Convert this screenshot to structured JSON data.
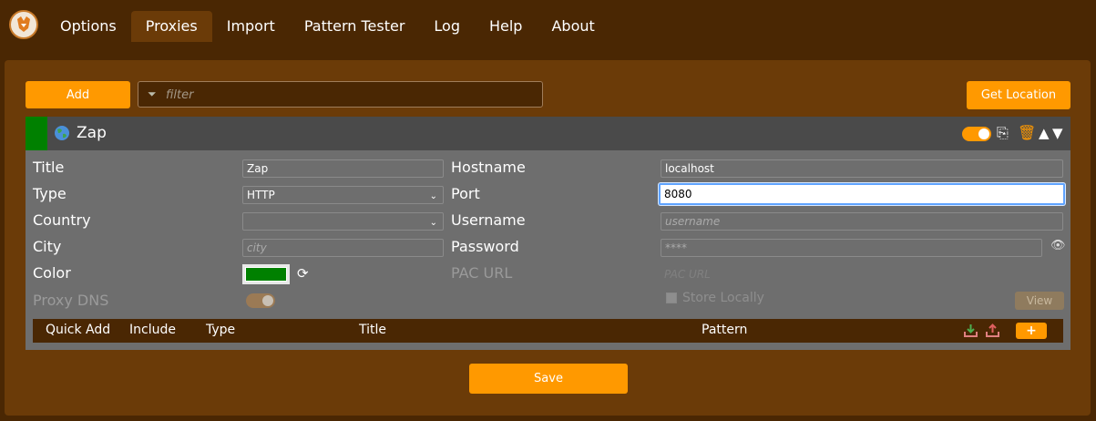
{
  "nav": {
    "tabs": [
      {
        "label": "Options"
      },
      {
        "label": "Proxies"
      },
      {
        "label": "Import"
      },
      {
        "label": "Pattern Tester"
      },
      {
        "label": "Log"
      },
      {
        "label": "Help"
      },
      {
        "label": "About"
      }
    ],
    "active": "Proxies"
  },
  "toolbar": {
    "add_label": "Add",
    "filter_placeholder": "filter",
    "get_location_label": "Get Location"
  },
  "proxy": {
    "name": "Zap",
    "enabled": true,
    "color": "#008000",
    "fields": {
      "title_label": "Title",
      "title_value": "Zap",
      "type_label": "Type",
      "type_value": "HTTP",
      "country_label": "Country",
      "country_value": "",
      "city_label": "City",
      "city_placeholder": "city",
      "color_label": "Color",
      "proxy_dns_label": "Proxy DNS",
      "hostname_label": "Hostname",
      "hostname_value": "localhost",
      "port_label": "Port",
      "port_value": "8080",
      "username_label": "Username",
      "username_placeholder": "username",
      "password_label": "Password",
      "password_placeholder": "****",
      "pac_url_label": "PAC URL",
      "pac_url_placeholder": "PAC URL",
      "store_locally_label": "Store Locally",
      "view_label": "View"
    },
    "pattern_columns": [
      "Quick Add",
      "Include",
      "Type",
      "Title",
      "Pattern"
    ],
    "add_pattern_label": "+"
  },
  "footer": {
    "save_label": "Save"
  },
  "colors": {
    "accent": "#ff9900",
    "background": "#4a2703",
    "panel": "#6b3b08"
  }
}
